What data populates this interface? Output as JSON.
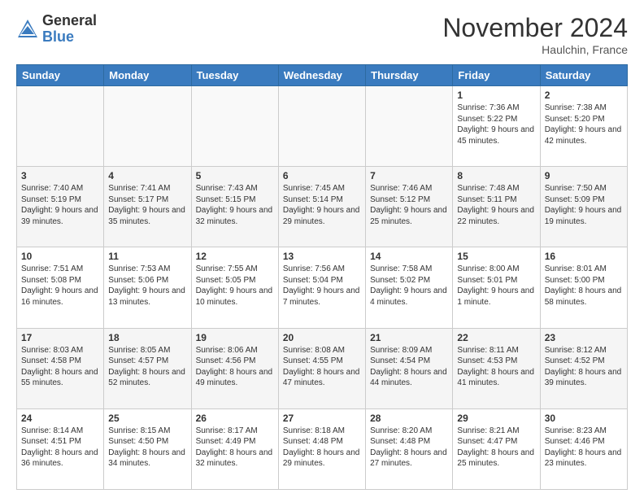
{
  "header": {
    "logo_general": "General",
    "logo_blue": "Blue",
    "month_title": "November 2024",
    "location": "Haulchin, France"
  },
  "weekdays": [
    "Sunday",
    "Monday",
    "Tuesday",
    "Wednesday",
    "Thursday",
    "Friday",
    "Saturday"
  ],
  "weeks": [
    [
      {
        "day": "",
        "info": ""
      },
      {
        "day": "",
        "info": ""
      },
      {
        "day": "",
        "info": ""
      },
      {
        "day": "",
        "info": ""
      },
      {
        "day": "",
        "info": ""
      },
      {
        "day": "1",
        "info": "Sunrise: 7:36 AM\nSunset: 5:22 PM\nDaylight: 9 hours and 45 minutes."
      },
      {
        "day": "2",
        "info": "Sunrise: 7:38 AM\nSunset: 5:20 PM\nDaylight: 9 hours and 42 minutes."
      }
    ],
    [
      {
        "day": "3",
        "info": "Sunrise: 7:40 AM\nSunset: 5:19 PM\nDaylight: 9 hours and 39 minutes."
      },
      {
        "day": "4",
        "info": "Sunrise: 7:41 AM\nSunset: 5:17 PM\nDaylight: 9 hours and 35 minutes."
      },
      {
        "day": "5",
        "info": "Sunrise: 7:43 AM\nSunset: 5:15 PM\nDaylight: 9 hours and 32 minutes."
      },
      {
        "day": "6",
        "info": "Sunrise: 7:45 AM\nSunset: 5:14 PM\nDaylight: 9 hours and 29 minutes."
      },
      {
        "day": "7",
        "info": "Sunrise: 7:46 AM\nSunset: 5:12 PM\nDaylight: 9 hours and 25 minutes."
      },
      {
        "day": "8",
        "info": "Sunrise: 7:48 AM\nSunset: 5:11 PM\nDaylight: 9 hours and 22 minutes."
      },
      {
        "day": "9",
        "info": "Sunrise: 7:50 AM\nSunset: 5:09 PM\nDaylight: 9 hours and 19 minutes."
      }
    ],
    [
      {
        "day": "10",
        "info": "Sunrise: 7:51 AM\nSunset: 5:08 PM\nDaylight: 9 hours and 16 minutes."
      },
      {
        "day": "11",
        "info": "Sunrise: 7:53 AM\nSunset: 5:06 PM\nDaylight: 9 hours and 13 minutes."
      },
      {
        "day": "12",
        "info": "Sunrise: 7:55 AM\nSunset: 5:05 PM\nDaylight: 9 hours and 10 minutes."
      },
      {
        "day": "13",
        "info": "Sunrise: 7:56 AM\nSunset: 5:04 PM\nDaylight: 9 hours and 7 minutes."
      },
      {
        "day": "14",
        "info": "Sunrise: 7:58 AM\nSunset: 5:02 PM\nDaylight: 9 hours and 4 minutes."
      },
      {
        "day": "15",
        "info": "Sunrise: 8:00 AM\nSunset: 5:01 PM\nDaylight: 9 hours and 1 minute."
      },
      {
        "day": "16",
        "info": "Sunrise: 8:01 AM\nSunset: 5:00 PM\nDaylight: 8 hours and 58 minutes."
      }
    ],
    [
      {
        "day": "17",
        "info": "Sunrise: 8:03 AM\nSunset: 4:58 PM\nDaylight: 8 hours and 55 minutes."
      },
      {
        "day": "18",
        "info": "Sunrise: 8:05 AM\nSunset: 4:57 PM\nDaylight: 8 hours and 52 minutes."
      },
      {
        "day": "19",
        "info": "Sunrise: 8:06 AM\nSunset: 4:56 PM\nDaylight: 8 hours and 49 minutes."
      },
      {
        "day": "20",
        "info": "Sunrise: 8:08 AM\nSunset: 4:55 PM\nDaylight: 8 hours and 47 minutes."
      },
      {
        "day": "21",
        "info": "Sunrise: 8:09 AM\nSunset: 4:54 PM\nDaylight: 8 hours and 44 minutes."
      },
      {
        "day": "22",
        "info": "Sunrise: 8:11 AM\nSunset: 4:53 PM\nDaylight: 8 hours and 41 minutes."
      },
      {
        "day": "23",
        "info": "Sunrise: 8:12 AM\nSunset: 4:52 PM\nDaylight: 8 hours and 39 minutes."
      }
    ],
    [
      {
        "day": "24",
        "info": "Sunrise: 8:14 AM\nSunset: 4:51 PM\nDaylight: 8 hours and 36 minutes."
      },
      {
        "day": "25",
        "info": "Sunrise: 8:15 AM\nSunset: 4:50 PM\nDaylight: 8 hours and 34 minutes."
      },
      {
        "day": "26",
        "info": "Sunrise: 8:17 AM\nSunset: 4:49 PM\nDaylight: 8 hours and 32 minutes."
      },
      {
        "day": "27",
        "info": "Sunrise: 8:18 AM\nSunset: 4:48 PM\nDaylight: 8 hours and 29 minutes."
      },
      {
        "day": "28",
        "info": "Sunrise: 8:20 AM\nSunset: 4:48 PM\nDaylight: 8 hours and 27 minutes."
      },
      {
        "day": "29",
        "info": "Sunrise: 8:21 AM\nSunset: 4:47 PM\nDaylight: 8 hours and 25 minutes."
      },
      {
        "day": "30",
        "info": "Sunrise: 8:23 AM\nSunset: 4:46 PM\nDaylight: 8 hours and 23 minutes."
      }
    ]
  ]
}
